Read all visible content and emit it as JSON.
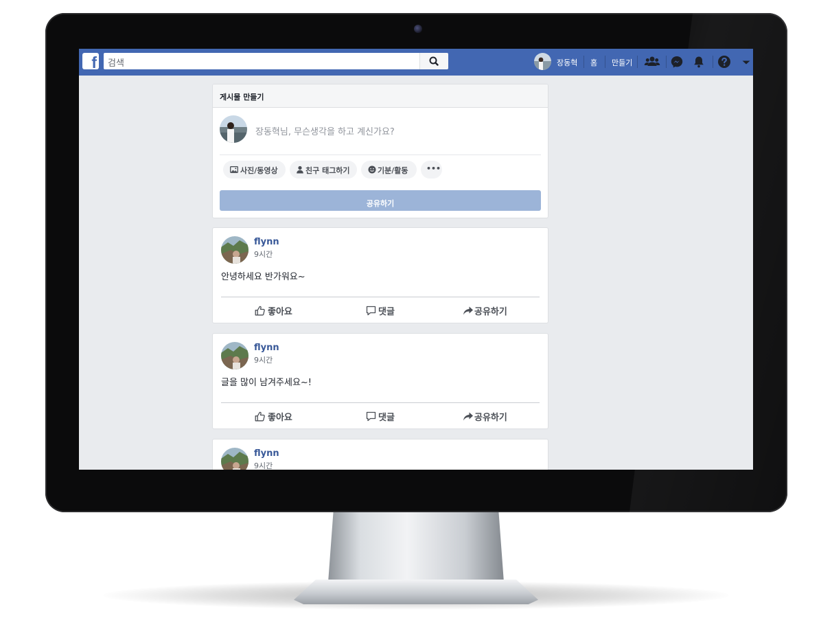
{
  "topbar": {
    "logo": "f",
    "search_placeholder": "검색",
    "user_name": "장동혁",
    "nav_home": "홈",
    "nav_create": "만들기",
    "icons": [
      "friends-icon",
      "messenger-icon",
      "bell-icon",
      "help-icon",
      "caret-down-icon"
    ],
    "colors": {
      "brand": "#4267b2",
      "background": "#e9ebee",
      "link": "#385898"
    }
  },
  "composer": {
    "header": "게시물 만들기",
    "prompt": "장동혁님, 무슨생각을 하고 계신가요?",
    "chips": [
      {
        "label": "사진/동영상",
        "icon": "photo-icon"
      },
      {
        "label": "친구 태그하기",
        "icon": "person-icon"
      },
      {
        "label": "기분/활동",
        "icon": "smiley-icon"
      },
      {
        "label": "•••",
        "icon": "more-icon"
      }
    ],
    "share_label": "공유하기"
  },
  "posts": [
    {
      "author": "flynn",
      "time": "9시간",
      "text": "안녕하세요 반가워요~"
    },
    {
      "author": "flynn",
      "time": "9시간",
      "text": "글을 많이 남겨주세요~!"
    },
    {
      "author": "flynn",
      "time": "9시간",
      "text": ""
    }
  ],
  "actions": {
    "like": "좋아요",
    "comment": "댓글",
    "share": "공유하기"
  }
}
